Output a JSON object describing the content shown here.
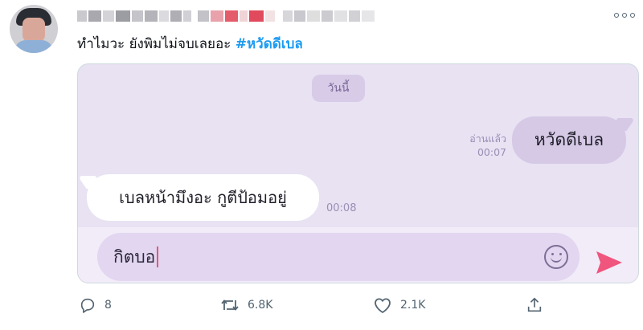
{
  "tweet": {
    "text": "ทำไมวะ ยังพิมไม่จบเลยอะ",
    "hashtag": "#หวัดดีเบล"
  },
  "chat": {
    "date_label": "วันนี้",
    "outgoing": {
      "text": "หวัดดีเบล",
      "status": "อ่านแล้ว",
      "time": "00:07"
    },
    "incoming": {
      "text": "เบลหน้ามึงอะ กูตีป้อมอยู่",
      "time": "00:08"
    },
    "input": {
      "value": "กิตบอ"
    }
  },
  "actions": {
    "replies": "8",
    "retweets": "6.8K",
    "likes": "2.1K"
  },
  "icons": [
    "more-icon",
    "emoji-icon",
    "send-icon",
    "reply-icon",
    "retweet-icon",
    "like-icon",
    "share-icon"
  ],
  "colors": {
    "hashtag": "#1d9bf0",
    "chat_background": "#e8e2f3",
    "outgoing_bubble": "#d6c9e6",
    "send_accent": "#f0557e"
  }
}
